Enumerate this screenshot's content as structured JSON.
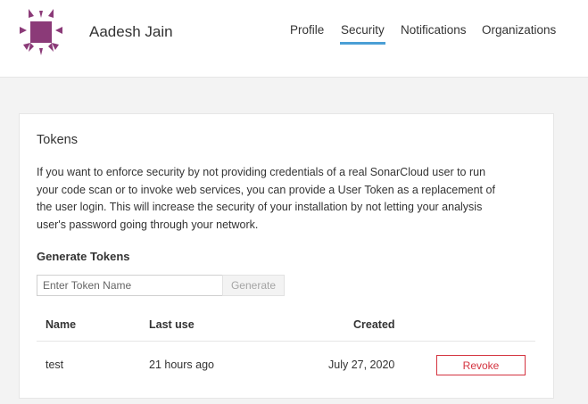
{
  "user": {
    "name": "Aadesh Jain"
  },
  "nav": {
    "items": [
      {
        "label": "Profile"
      },
      {
        "label": "Security"
      },
      {
        "label": "Notifications"
      },
      {
        "label": "Organizations"
      }
    ],
    "active": "Security"
  },
  "tokens_card": {
    "title": "Tokens",
    "description_lines": [
      "If you want to enforce security by not providing credentials of a real SonarCloud user to run",
      "your code scan or to invoke web services, you can provide a User Token as a replacement of",
      "the user login. This will increase the security of your installation by not letting your analysis",
      "user's password going through your network."
    ],
    "generate": {
      "title": "Generate Tokens",
      "input_placeholder": "Enter Token Name",
      "input_value": "",
      "button_label": "Generate"
    },
    "table": {
      "headers": {
        "name": "Name",
        "last_use": "Last use",
        "created": "Created"
      },
      "rows": [
        {
          "name": "test",
          "last_use": "21 hours ago",
          "created": "July 27, 2020",
          "action": "Revoke"
        }
      ]
    }
  },
  "colors": {
    "accent": "#4b9fd5",
    "danger": "#d4333f",
    "avatar": "#8b3a78",
    "background": "#f3f3f3"
  },
  "icons": {
    "avatar": "user-avatar-identicon"
  }
}
